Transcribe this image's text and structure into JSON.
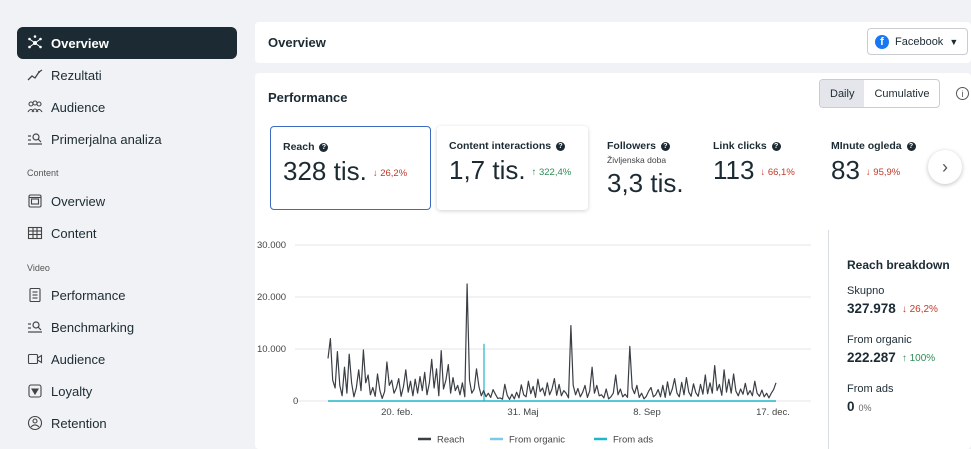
{
  "sidebar": {
    "items": [
      {
        "label": "Overview",
        "icon": "network-icon"
      },
      {
        "label": "Rezultati",
        "icon": "trend-icon"
      },
      {
        "label": "Audience",
        "icon": "people-icon"
      },
      {
        "label": "Primerjalna analiza",
        "icon": "benchmark-icon"
      }
    ],
    "content_section": "Content",
    "content_items": [
      {
        "label": "Overview",
        "icon": "content-overview-icon"
      },
      {
        "label": "Content",
        "icon": "table-icon"
      }
    ],
    "video_section": "Video",
    "video_items": [
      {
        "label": "Performance",
        "icon": "document-icon"
      },
      {
        "label": "Benchmarking",
        "icon": "benchmark-icon"
      },
      {
        "label": "Audience",
        "icon": "video-icon"
      },
      {
        "label": "Loyalty",
        "icon": "shield-icon"
      },
      {
        "label": "Retention",
        "icon": "retention-icon"
      }
    ]
  },
  "header": {
    "title": "Overview",
    "platform": "Facebook"
  },
  "performance": {
    "title": "Performance",
    "toggle": {
      "daily": "Daily",
      "cumulative": "Cumulative",
      "selected": "Daily"
    },
    "metrics": [
      {
        "label": "Reach",
        "value": "328 tis.",
        "delta": "↓ 26,2%",
        "direction": "down"
      },
      {
        "label": "Content interactions",
        "value": "1,7 tis.",
        "delta": "↑ 322,4%",
        "direction": "up"
      },
      {
        "label": "Followers",
        "sublabel": "Življenska doba",
        "value": "3,3 tis."
      },
      {
        "label": "Link clicks",
        "value": "113",
        "delta": "↓ 66,1%",
        "direction": "down"
      },
      {
        "label": "MInute ogleda",
        "value": "83",
        "delta": "↓ 95,9%",
        "direction": "down"
      }
    ]
  },
  "chart_data": {
    "type": "line",
    "title": "",
    "y_ticks": [
      "30.000",
      "20.000",
      "10.000",
      "0"
    ],
    "ylim": [
      0,
      30000
    ],
    "x_ticks": [
      "20. feb.",
      "31. Maj",
      "8. Sep",
      "17. dec."
    ],
    "legend_position": "bottom",
    "series": [
      {
        "name": "Reach",
        "color": "#3a3f45",
        "values": [
          8200,
          12000,
          4000,
          2500,
          9500,
          3000,
          1000,
          6500,
          1500,
          9000,
          3500,
          800,
          2500,
          6000,
          2000,
          9800,
          3500,
          5000,
          1200,
          2600,
          900,
          5200,
          2000,
          500,
          1800,
          7500,
          3000,
          4000,
          1500,
          2500,
          4300,
          900,
          2800,
          6000,
          1700,
          3800,
          1000,
          4200,
          1500,
          4700,
          2000,
          5500,
          1200,
          3500,
          8000,
          2500,
          6200,
          1000,
          9700,
          2300,
          4000,
          7000,
          1500,
          4500,
          2000,
          3000,
          1200,
          3500,
          800,
          22500,
          4000,
          1500,
          2300,
          6200,
          2800,
          1000,
          2000,
          800,
          1500,
          700,
          2200,
          1300,
          500,
          600,
          350,
          3200,
          1100,
          300,
          1300,
          400,
          1700,
          600,
          3100,
          1200,
          800,
          3800,
          1400,
          2800,
          700,
          4200,
          1800,
          2500,
          1000,
          3500,
          1200,
          2300,
          4300,
          1100,
          3200,
          1000,
          2000,
          1500,
          600,
          14500,
          3000,
          1200,
          2400,
          800,
          1700,
          3000,
          700,
          1900,
          6500,
          1500,
          3000,
          1000,
          1200,
          600,
          2300,
          400,
          800,
          1500,
          5000,
          1200,
          2300,
          800,
          1300,
          700,
          10500,
          2500,
          1400,
          3000,
          700,
          1500,
          400,
          900,
          1900,
          2600,
          800,
          1200,
          2200,
          800,
          3000,
          700,
          3700,
          1100,
          2300,
          4300,
          1500,
          800,
          3600,
          1200,
          4500,
          1700,
          900,
          3300,
          1600,
          900,
          3200,
          1300,
          5000,
          1400,
          3500,
          1500,
          6800,
          2000,
          3200,
          1100,
          6000,
          1700,
          4200,
          1500,
          5200,
          1900,
          1000,
          2300,
          1300,
          3400,
          1200,
          2000,
          1000,
          3800,
          1500,
          900,
          2100,
          800,
          1500,
          600,
          1500,
          2200,
          3500
        ]
      },
      {
        "name": "From organic",
        "color": "#7fc8e8",
        "values": [
          0
        ]
      },
      {
        "name": "From ads",
        "color": "#1fb6c9",
        "values": [
          0
        ]
      }
    ]
  },
  "breakdown": {
    "title": "Reach breakdown",
    "items": [
      {
        "label": "Skupno",
        "value": "327.978",
        "delta": "↓ 26,2%",
        "direction": "down"
      },
      {
        "label": "From organic",
        "value": "222.287",
        "delta": "↑ 100%",
        "direction": "up"
      },
      {
        "label": "From ads",
        "value": "0",
        "delta": "0%",
        "direction": "none"
      }
    ]
  }
}
